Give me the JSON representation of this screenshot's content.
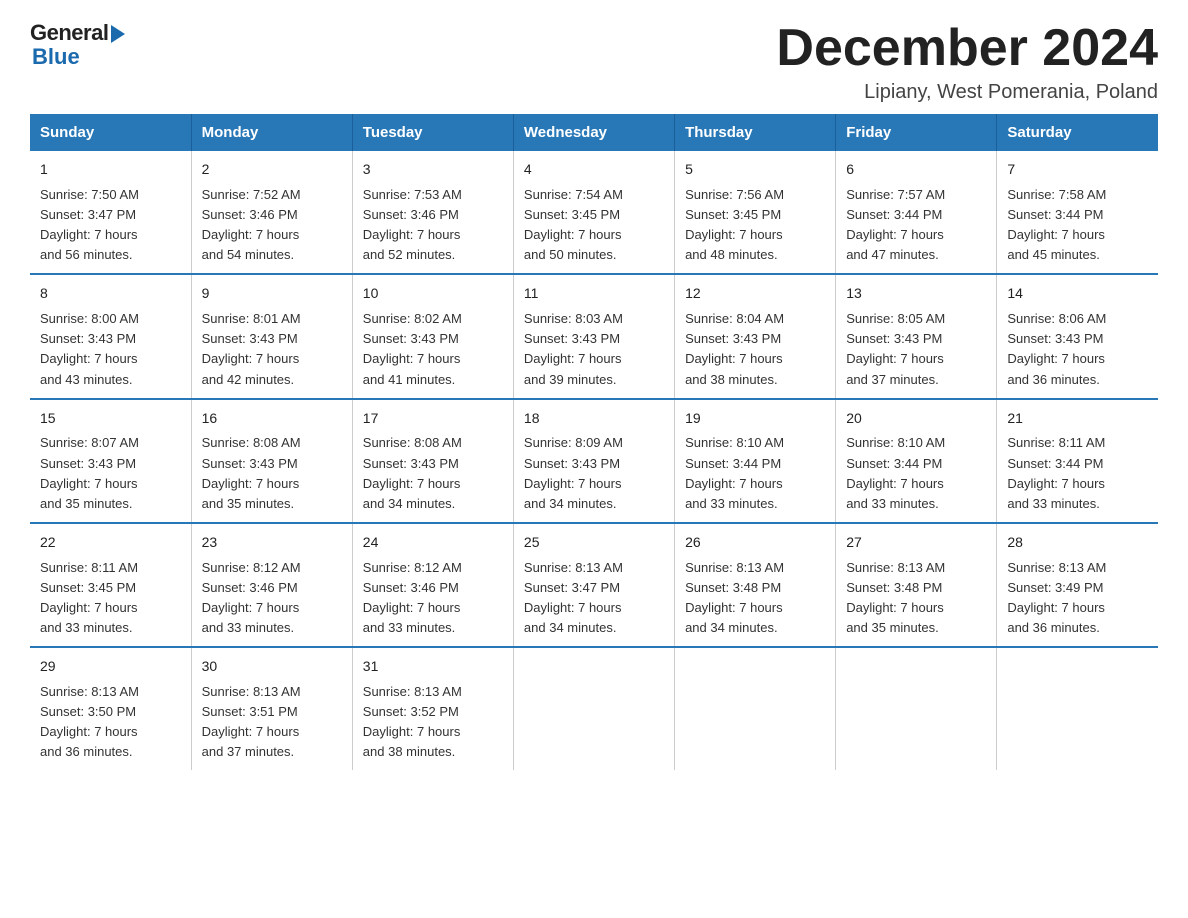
{
  "logo": {
    "general": "General",
    "blue": "Blue"
  },
  "title": "December 2024",
  "subtitle": "Lipiany, West Pomerania, Poland",
  "days_of_week": [
    "Sunday",
    "Monday",
    "Tuesday",
    "Wednesday",
    "Thursday",
    "Friday",
    "Saturday"
  ],
  "weeks": [
    [
      {
        "day": "1",
        "sunrise": "7:50 AM",
        "sunset": "3:47 PM",
        "daylight": "7 hours and 56 minutes."
      },
      {
        "day": "2",
        "sunrise": "7:52 AM",
        "sunset": "3:46 PM",
        "daylight": "7 hours and 54 minutes."
      },
      {
        "day": "3",
        "sunrise": "7:53 AM",
        "sunset": "3:46 PM",
        "daylight": "7 hours and 52 minutes."
      },
      {
        "day": "4",
        "sunrise": "7:54 AM",
        "sunset": "3:45 PM",
        "daylight": "7 hours and 50 minutes."
      },
      {
        "day": "5",
        "sunrise": "7:56 AM",
        "sunset": "3:45 PM",
        "daylight": "7 hours and 48 minutes."
      },
      {
        "day": "6",
        "sunrise": "7:57 AM",
        "sunset": "3:44 PM",
        "daylight": "7 hours and 47 minutes."
      },
      {
        "day": "7",
        "sunrise": "7:58 AM",
        "sunset": "3:44 PM",
        "daylight": "7 hours and 45 minutes."
      }
    ],
    [
      {
        "day": "8",
        "sunrise": "8:00 AM",
        "sunset": "3:43 PM",
        "daylight": "7 hours and 43 minutes."
      },
      {
        "day": "9",
        "sunrise": "8:01 AM",
        "sunset": "3:43 PM",
        "daylight": "7 hours and 42 minutes."
      },
      {
        "day": "10",
        "sunrise": "8:02 AM",
        "sunset": "3:43 PM",
        "daylight": "7 hours and 41 minutes."
      },
      {
        "day": "11",
        "sunrise": "8:03 AM",
        "sunset": "3:43 PM",
        "daylight": "7 hours and 39 minutes."
      },
      {
        "day": "12",
        "sunrise": "8:04 AM",
        "sunset": "3:43 PM",
        "daylight": "7 hours and 38 minutes."
      },
      {
        "day": "13",
        "sunrise": "8:05 AM",
        "sunset": "3:43 PM",
        "daylight": "7 hours and 37 minutes."
      },
      {
        "day": "14",
        "sunrise": "8:06 AM",
        "sunset": "3:43 PM",
        "daylight": "7 hours and 36 minutes."
      }
    ],
    [
      {
        "day": "15",
        "sunrise": "8:07 AM",
        "sunset": "3:43 PM",
        "daylight": "7 hours and 35 minutes."
      },
      {
        "day": "16",
        "sunrise": "8:08 AM",
        "sunset": "3:43 PM",
        "daylight": "7 hours and 35 minutes."
      },
      {
        "day": "17",
        "sunrise": "8:08 AM",
        "sunset": "3:43 PM",
        "daylight": "7 hours and 34 minutes."
      },
      {
        "day": "18",
        "sunrise": "8:09 AM",
        "sunset": "3:43 PM",
        "daylight": "7 hours and 34 minutes."
      },
      {
        "day": "19",
        "sunrise": "8:10 AM",
        "sunset": "3:44 PM",
        "daylight": "7 hours and 33 minutes."
      },
      {
        "day": "20",
        "sunrise": "8:10 AM",
        "sunset": "3:44 PM",
        "daylight": "7 hours and 33 minutes."
      },
      {
        "day": "21",
        "sunrise": "8:11 AM",
        "sunset": "3:44 PM",
        "daylight": "7 hours and 33 minutes."
      }
    ],
    [
      {
        "day": "22",
        "sunrise": "8:11 AM",
        "sunset": "3:45 PM",
        "daylight": "7 hours and 33 minutes."
      },
      {
        "day": "23",
        "sunrise": "8:12 AM",
        "sunset": "3:46 PM",
        "daylight": "7 hours and 33 minutes."
      },
      {
        "day": "24",
        "sunrise": "8:12 AM",
        "sunset": "3:46 PM",
        "daylight": "7 hours and 33 minutes."
      },
      {
        "day": "25",
        "sunrise": "8:13 AM",
        "sunset": "3:47 PM",
        "daylight": "7 hours and 34 minutes."
      },
      {
        "day": "26",
        "sunrise": "8:13 AM",
        "sunset": "3:48 PM",
        "daylight": "7 hours and 34 minutes."
      },
      {
        "day": "27",
        "sunrise": "8:13 AM",
        "sunset": "3:48 PM",
        "daylight": "7 hours and 35 minutes."
      },
      {
        "day": "28",
        "sunrise": "8:13 AM",
        "sunset": "3:49 PM",
        "daylight": "7 hours and 36 minutes."
      }
    ],
    [
      {
        "day": "29",
        "sunrise": "8:13 AM",
        "sunset": "3:50 PM",
        "daylight": "7 hours and 36 minutes."
      },
      {
        "day": "30",
        "sunrise": "8:13 AM",
        "sunset": "3:51 PM",
        "daylight": "7 hours and 37 minutes."
      },
      {
        "day": "31",
        "sunrise": "8:13 AM",
        "sunset": "3:52 PM",
        "daylight": "7 hours and 38 minutes."
      },
      null,
      null,
      null,
      null
    ]
  ],
  "labels": {
    "sunrise": "Sunrise:",
    "sunset": "Sunset:",
    "daylight": "Daylight:"
  }
}
